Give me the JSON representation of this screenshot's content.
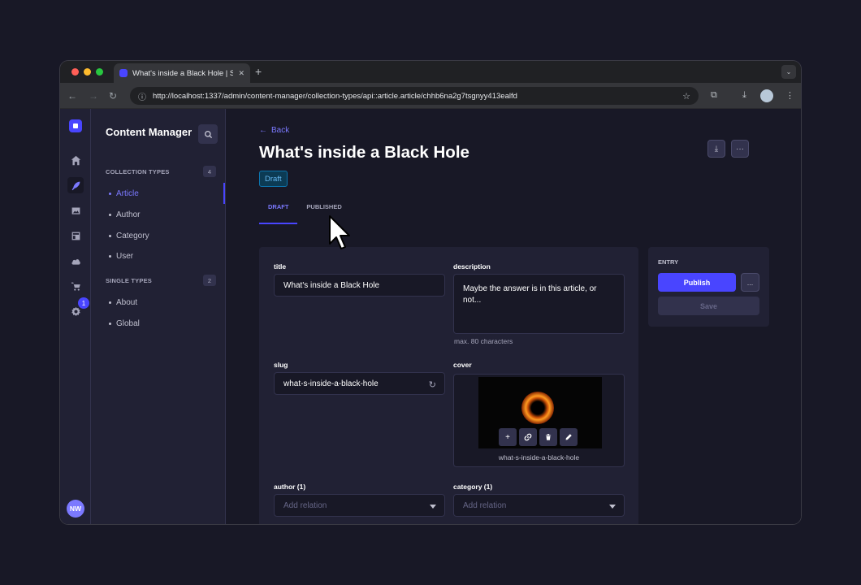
{
  "browser": {
    "tab_title": "What's inside a Black Hole | S",
    "url": "http://localhost:1337/admin/content-manager/collection-types/api::article.article/chhb6na2g7tsgnyy413ealfd"
  },
  "mainnav": {
    "settings_badge": "1",
    "avatar_initials": "NW"
  },
  "subnav": {
    "title": "Content Manager",
    "collection_types": {
      "label": "COLLECTION TYPES",
      "count": "4",
      "items": [
        "Article",
        "Author",
        "Category",
        "User"
      ]
    },
    "single_types": {
      "label": "SINGLE TYPES",
      "count": "2",
      "items": [
        "About",
        "Global"
      ]
    }
  },
  "header": {
    "back_label": "Back",
    "title": "What's inside a Black Hole",
    "status": "Draft"
  },
  "tabs": [
    "DRAFT",
    "PUBLISHED"
  ],
  "form": {
    "title": {
      "label": "title",
      "value": "What's inside a Black Hole"
    },
    "description": {
      "label": "description",
      "value": "Maybe the answer is in this article, or not...",
      "hint": "max. 80 characters"
    },
    "slug": {
      "label": "slug",
      "value": "what-s-inside-a-black-hole"
    },
    "cover": {
      "label": "cover",
      "filename": "what-s-inside-a-black-hole"
    },
    "author": {
      "label": "author (1)",
      "placeholder": "Add relation"
    },
    "category": {
      "label": "category (1)",
      "placeholder": "Add relation"
    }
  },
  "entry_panel": {
    "label": "ENTRY",
    "publish_label": "Publish",
    "more_label": "...",
    "save_label": "Save"
  },
  "colors": {
    "primary": "#4945ff",
    "primary_text": "#7b79ff",
    "background": "#181826",
    "surface": "#212134",
    "status_draft": "#66b7f1"
  }
}
